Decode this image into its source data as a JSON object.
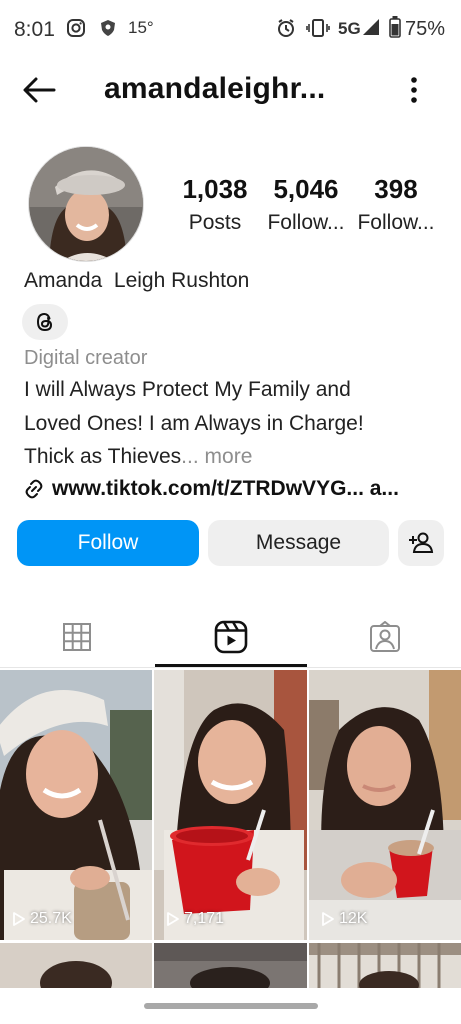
{
  "status_bar": {
    "time": "8:01",
    "temperature": "15°",
    "network": "5G",
    "battery": "75%"
  },
  "header": {
    "username": "amandaleighr..."
  },
  "stats": [
    {
      "value": "1,038",
      "label": "Posts"
    },
    {
      "value": "5,046",
      "label": "Follow..."
    },
    {
      "value": "398",
      "label": "Follow..."
    }
  ],
  "profile": {
    "name": "Amanda  Leigh Rushton",
    "category": "Digital creator",
    "bio_lines": [
      "I will Always Protect My Family and",
      "Loved Ones! I am Always in Charge!",
      "Thick as Thieves"
    ],
    "bio_ellipsis": "...",
    "more_label": "more",
    "link": "www.tiktok.com/t/ZTRDwVYG... a..."
  },
  "actions": {
    "follow_label": "Follow",
    "message_label": "Message"
  },
  "tabs": [
    {
      "name": "posts-grid",
      "icon": "grid-icon",
      "active": false
    },
    {
      "name": "reels",
      "icon": "reels-icon",
      "active": true
    },
    {
      "name": "tagged",
      "icon": "tagged-icon",
      "active": false
    }
  ],
  "reels": [
    {
      "views": "25.7K"
    },
    {
      "views": "7,171"
    },
    {
      "views": "12K"
    }
  ],
  "colors": {
    "accent": "#0095f6",
    "button_gray": "#efefef",
    "secondary_text": "#8e8e8e"
  }
}
